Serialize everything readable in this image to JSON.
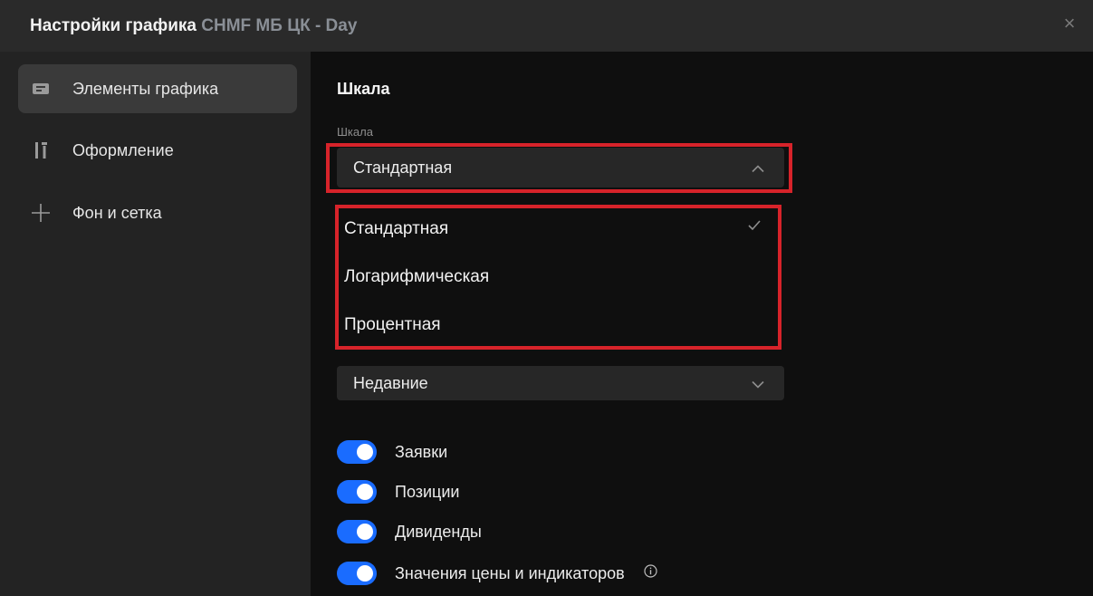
{
  "window": {
    "title": "Настройки графика",
    "subtitle": "CHMF МБ ЦК - Day",
    "close_glyph": "×"
  },
  "sidebar": {
    "items": [
      {
        "label": "Элементы графика",
        "icon": "chart-elements-icon",
        "active": true
      },
      {
        "label": "Оформление",
        "icon": "appearance-icon",
        "active": false
      },
      {
        "label": "Фон и сетка",
        "icon": "grid-icon",
        "active": false
      }
    ]
  },
  "main": {
    "section_title": "Шкала",
    "scale_label": "Шкала",
    "scale_value": "Стандартная",
    "scale_options": [
      "Стандартная",
      "Логарифмическая",
      "Процентная"
    ],
    "selected_option_index": 0,
    "second_select_value": "Недавние",
    "toggles": [
      {
        "label": "Заявки",
        "on": true
      },
      {
        "label": "Позиции",
        "on": true
      },
      {
        "label": "Дивиденды",
        "on": true
      },
      {
        "label": "Значения цены и индикаторов",
        "on": true,
        "info": true
      }
    ]
  },
  "colors": {
    "accent": "#1a6cff",
    "highlight_frame": "#d7232a",
    "sidebar_bg": "#232323",
    "titlebar_bg": "#2a2a2a",
    "main_bg": "#0f0f0f"
  }
}
